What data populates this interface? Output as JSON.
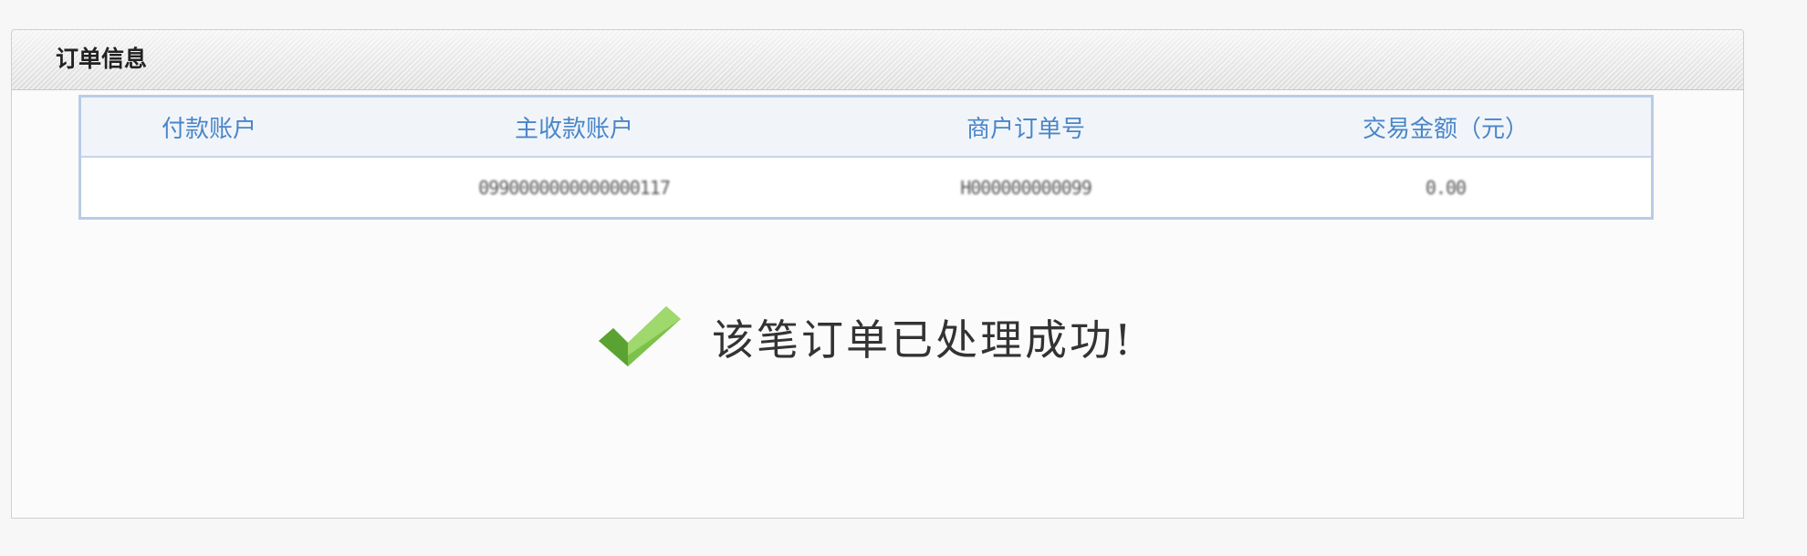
{
  "panel": {
    "title": "订单信息"
  },
  "table": {
    "headers": [
      "付款账户",
      "主收款账户",
      "商户订单号",
      "交易金额（元）"
    ],
    "row": {
      "payer_account": "",
      "payee_account": "0990000000000000117",
      "merchant_order_no": "H000000000099",
      "amount": "0.00"
    }
  },
  "result": {
    "icon": "check-icon",
    "message": "该笔订单已处理成功!"
  }
}
